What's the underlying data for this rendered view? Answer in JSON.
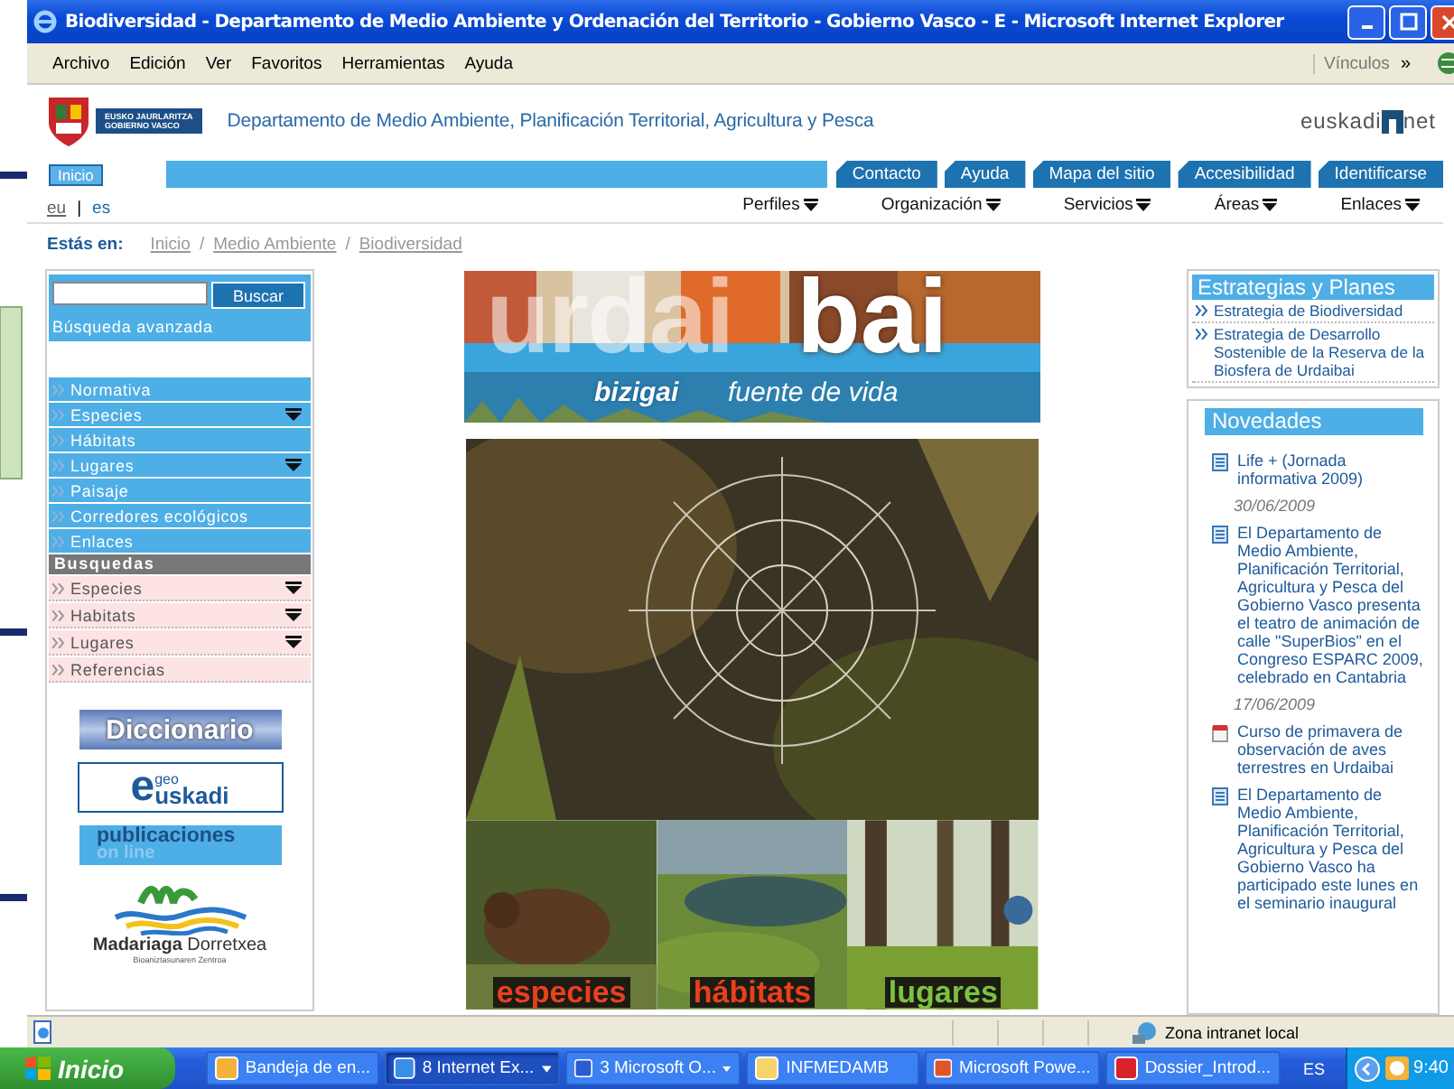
{
  "window": {
    "title": "Biodiversidad - Departamento de Medio Ambiente y Ordenación del Territorio - Gobierno Vasco - E - Microsoft Internet Explorer"
  },
  "menu_bar": {
    "items": [
      "Archivo",
      "Edición",
      "Ver",
      "Favoritos",
      "Herramientas",
      "Ayuda"
    ],
    "links_label": "Vínculos",
    "more": "»"
  },
  "header": {
    "gov_logo": [
      "EUSKO JAURLARITZA",
      "GOBIERNO VASCO"
    ],
    "department": "Departamento de Medio Ambiente, Planificación Territorial, Agricultura y Pesca",
    "portal_logo": {
      "left": "euskadi",
      "right": "net"
    }
  },
  "top_nav": {
    "home": "Inicio",
    "tabs": [
      "Contacto",
      "Ayuda",
      "Mapa del sitio",
      "Accesibilidad",
      "Identificarse"
    ]
  },
  "languages": {
    "separator": "|",
    "items": [
      {
        "label": "eu",
        "selected": false
      },
      {
        "label": "es",
        "selected": true
      }
    ]
  },
  "menus": [
    {
      "label": "Perfiles",
      "has_menu": true
    },
    {
      "label": "Organización",
      "has_menu": true
    },
    {
      "label": "Servicios",
      "has_menu": true
    },
    {
      "label": "Áreas",
      "has_menu": true
    },
    {
      "label": "Enlaces",
      "has_menu": true
    }
  ],
  "breadcrumb": {
    "label": "Estás en:",
    "separator": "/",
    "items": [
      "Inicio",
      "Medio Ambiente",
      "Biodiversidad"
    ]
  },
  "search": {
    "button": "Buscar",
    "advanced": "Búsqueda avanzada"
  },
  "sidebar": {
    "items": [
      {
        "label": "Normativa",
        "has_menu": false
      },
      {
        "label": "Especies",
        "has_menu": true
      },
      {
        "label": "Hábitats",
        "has_menu": false
      },
      {
        "label": "Lugares",
        "has_menu": true
      },
      {
        "label": "Paisaje",
        "has_menu": false
      },
      {
        "label": "Corredores ecológicos",
        "has_menu": false
      },
      {
        "label": "Enlaces",
        "has_menu": false
      }
    ],
    "search_heading": "Busquedas",
    "search_items": [
      {
        "label": "Especies",
        "has_menu": true
      },
      {
        "label": "Habitats",
        "has_menu": true
      },
      {
        "label": "Lugares",
        "has_menu": true
      },
      {
        "label": "Referencias",
        "has_menu": false
      }
    ]
  },
  "promos": [
    {
      "kind": "diccionario",
      "text": "Diccionario"
    },
    {
      "kind": "geo",
      "letter": "e",
      "small": "geo",
      "text": "uskadi"
    },
    {
      "kind": "publicaciones",
      "text": "publicaciones",
      "sub": "on line"
    },
    {
      "kind": "madariaga",
      "bold": "Madariaga",
      "text": "Dorretxea",
      "sub": "Bioaniztasunaren Zentroa"
    }
  ],
  "banner": {
    "title_light": "urdai",
    "title_bold": "bai",
    "tagline_bold": "bizigai",
    "tagline": "fuente de vida"
  },
  "sections": [
    {
      "label": "especies"
    },
    {
      "label": "hábitats"
    },
    {
      "label": "lugares"
    }
  ],
  "strategies": {
    "title": "Estrategias y Planes",
    "items": [
      "Estrategia de Biodiversidad",
      "Estrategia de Desarrollo Sostenible de la Reserva de la Biosfera de Urdaibai"
    ]
  },
  "news": {
    "title": "Novedades",
    "entries": [
      {
        "kind": "doc",
        "text": "Life + (Jornada informativa 2009)"
      },
      {
        "kind": "date",
        "text": "30/06/2009"
      },
      {
        "kind": "doc",
        "text": "El Departamento de Medio Ambiente, Planificación Territorial, Agricultura y Pesca del Gobierno Vasco presenta el teatro de animación de calle \"SuperBios\" en el Congreso ESPARC 2009, celebrado en Cantabria"
      },
      {
        "kind": "date",
        "text": "17/06/2009"
      },
      {
        "kind": "event",
        "text": "Curso de primavera de observación de aves terrestres en Urdaibai"
      },
      {
        "kind": "doc",
        "text": "El Departamento de Medio Ambiente, Planificación Territorial, Agricultura y Pesca del Gobierno Vasco ha participado este lunes en el seminario inaugural"
      }
    ]
  },
  "status_bar": {
    "zone": "Zona intranet local"
  },
  "taskbar": {
    "start": "Inicio",
    "tasks": [
      {
        "kind": "mail",
        "label": "Bandeja de en...",
        "selected": false,
        "grouped": false
      },
      {
        "kind": "browser",
        "label": "8 Internet Ex...",
        "selected": true,
        "grouped": true
      },
      {
        "kind": "word",
        "label": "3 Microsoft O...",
        "selected": false,
        "grouped": true
      },
      {
        "kind": "folder",
        "label": "INFMEDAMB",
        "selected": false,
        "grouped": false
      },
      {
        "kind": "slides",
        "label": "Microsoft Powe...",
        "selected": false,
        "grouped": false
      },
      {
        "kind": "pdf",
        "label": "Dossier_Introd...",
        "selected": false,
        "grouped": false
      }
    ],
    "language": "ES",
    "clock": "9:40"
  }
}
